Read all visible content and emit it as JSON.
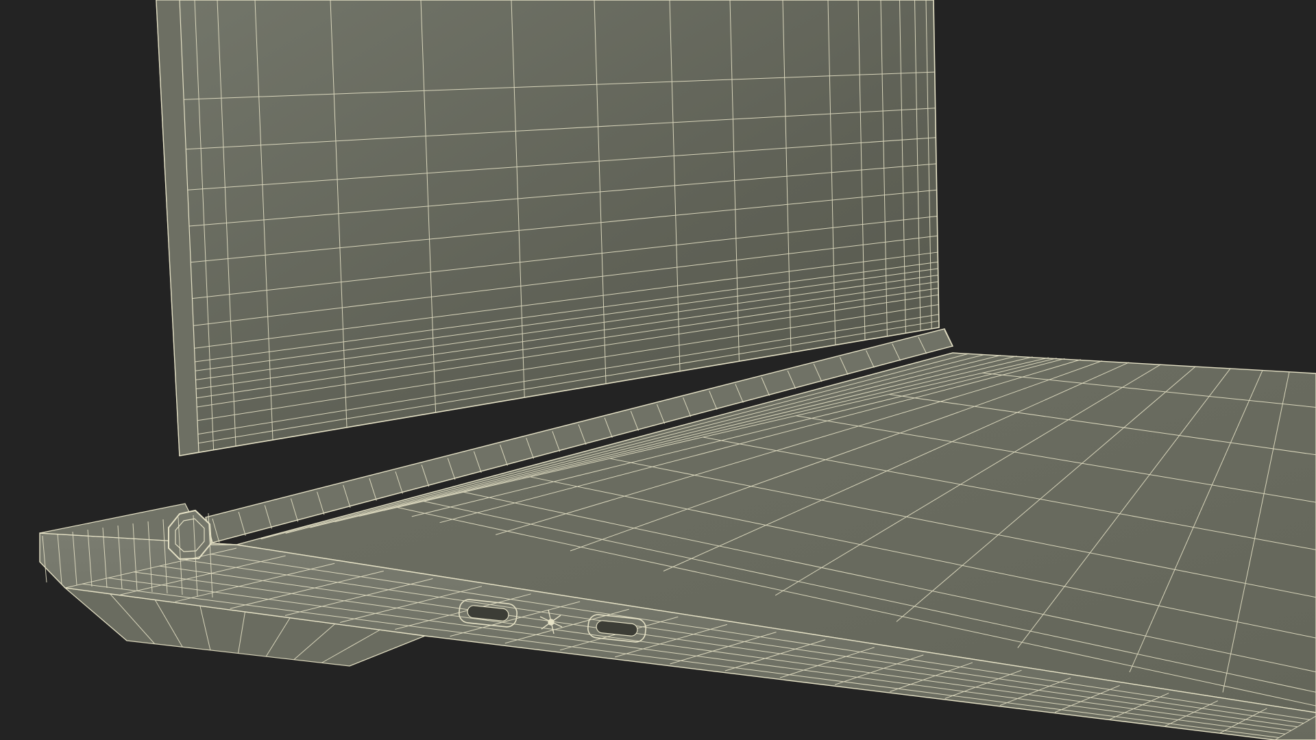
{
  "scene": {
    "subject": "laptop-wireframe-render",
    "colors": {
      "background": "#232323",
      "surface_light": "#74766a",
      "surface_mid": "#686a5e",
      "surface_dark": "#55574c",
      "wire": "#e6e2c6",
      "wire_soft": "#cfcbb0",
      "port_fill": "#3c3d36"
    },
    "usb_c_port_count": 2,
    "icons": [
      "lightning-icon"
    ]
  }
}
